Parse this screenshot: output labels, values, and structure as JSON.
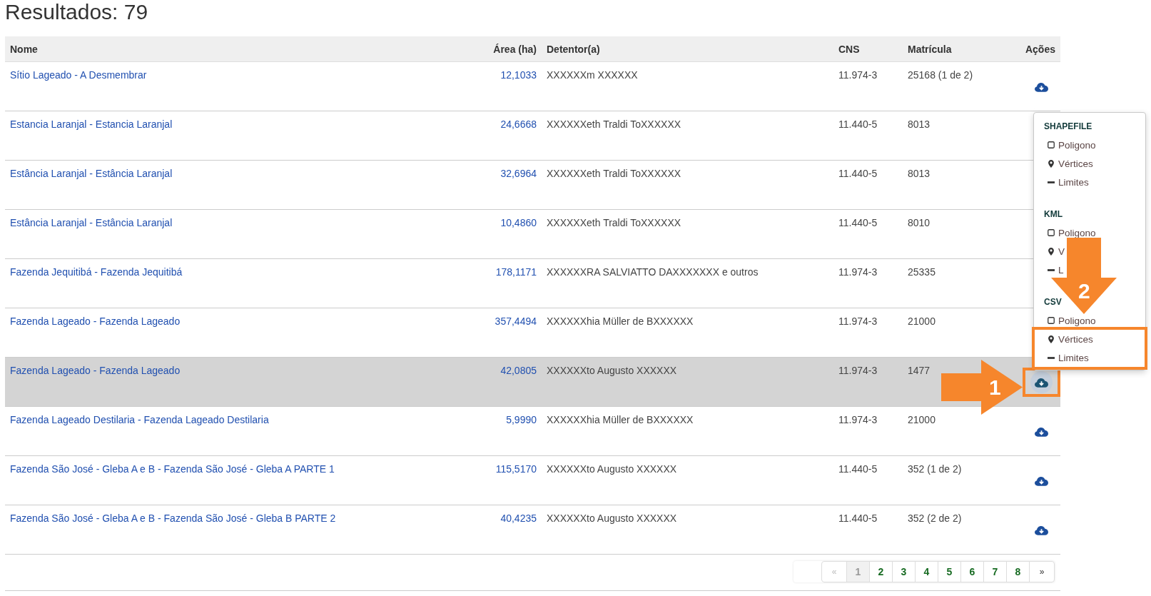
{
  "title": "Resultados: 79",
  "table": {
    "columns": [
      {
        "label": "Nome",
        "kind": "link"
      },
      {
        "label": "Área (ha)",
        "kind": "number"
      },
      {
        "label": "Detentor(a)",
        "kind": "text"
      },
      {
        "label": "CNS",
        "kind": "text"
      },
      {
        "label": "Matrícula",
        "kind": "text"
      },
      {
        "label": "Ações",
        "kind": "actions"
      }
    ],
    "rows": [
      {
        "cells": [
          "Sítio Lageado - A Desmembrar",
          "12,1033",
          "XXXXXXm XXXXXX",
          "11.974-3",
          "25168 (1 de 2)"
        ],
        "selected": false,
        "download": {
          "open": false,
          "highlighted": false
        }
      },
      {
        "cells": [
          "Estancia Laranjal - Estancia Laranjal",
          "24,6668",
          "XXXXXXeth Traldi ToXXXXXX",
          "11.440-5",
          "8013"
        ],
        "selected": false
      },
      {
        "cells": [
          "Estância Laranjal - Estância Laranjal",
          "32,6964",
          "XXXXXXeth Traldi ToXXXXXX",
          "11.440-5",
          "8013"
        ],
        "selected": false
      },
      {
        "cells": [
          "Estância Laranjal - Estância Laranjal",
          "10,4860",
          "XXXXXXeth Traldi ToXXXXXX",
          "11.440-5",
          "8010"
        ],
        "selected": false
      },
      {
        "cells": [
          "Fazenda Jequitibá - Fazenda Jequitibá",
          "178,1171",
          "XXXXXXRA SALVIATTO DAXXXXXXX e outros",
          "11.974-3",
          "25335"
        ],
        "selected": false
      },
      {
        "cells": [
          "Fazenda Lageado - Fazenda Lageado",
          "357,4494",
          "XXXXXXhia Müller de BXXXXXX",
          "11.974-3",
          "21000"
        ],
        "selected": false
      },
      {
        "cells": [
          "Fazenda Lageado - Fazenda Lageado",
          "42,0805",
          "XXXXXXto Augusto XXXXXX",
          "11.974-3",
          "1477"
        ],
        "selected": true,
        "download": {
          "open": true,
          "highlighted": true
        }
      },
      {
        "cells": [
          "Fazenda Lageado Destilaria - Fazenda Lageado Destilaria",
          "5,9990",
          "XXXXXXhia Müller de BXXXXXX",
          "11.974-3",
          "21000"
        ],
        "selected": false,
        "download": {
          "open": false,
          "highlighted": false
        }
      },
      {
        "cells": [
          "Fazenda São José - Gleba A e B - Fazenda São José - Gleba A PARTE 1",
          "115,5170",
          "XXXXXXto Augusto XXXXXX",
          "11.440-5",
          "352 (1 de 2)"
        ],
        "selected": false,
        "download": {
          "open": false,
          "highlighted": false
        }
      },
      {
        "cells": [
          "Fazenda São José - Gleba A e B - Fazenda São José - Gleba B PARTE 2",
          "40,4235",
          "XXXXXXto Augusto XXXXXX",
          "11.440-5",
          "352 (2 de 2)"
        ],
        "selected": false,
        "download": {
          "open": false,
          "highlighted": false
        }
      }
    ]
  },
  "download_menu": {
    "sections": [
      {
        "title": "SHAPEFILE",
        "items": [
          {
            "label": "Poligono",
            "kind": "polygon",
            "highlighted": false
          },
          {
            "label": "Vértices",
            "kind": "points",
            "highlighted": false
          },
          {
            "label": "Limites",
            "kind": "lines",
            "highlighted": false
          }
        ]
      },
      {
        "title": "KML",
        "items": [
          {
            "label": "Poligono",
            "kind": "polygon",
            "highlighted": false
          },
          {
            "label": "V",
            "kind": "points",
            "highlighted": false
          },
          {
            "label": "L",
            "kind": "lines",
            "highlighted": false
          }
        ]
      },
      {
        "title": "CSV",
        "items": [
          {
            "label": "Poligono",
            "kind": "polygon",
            "highlighted": false
          },
          {
            "label": "Vértices",
            "kind": "points",
            "highlighted": true
          },
          {
            "label": "Limites",
            "kind": "lines",
            "highlighted": true
          }
        ]
      }
    ]
  },
  "pagination": {
    "pages": [
      {
        "label": "«",
        "kind": "prev",
        "selected": false,
        "disabled": true
      },
      {
        "label": "1",
        "kind": "page",
        "selected": true,
        "disabled": false
      },
      {
        "label": "2",
        "kind": "page",
        "selected": false,
        "disabled": false
      },
      {
        "label": "3",
        "kind": "page",
        "selected": false,
        "disabled": false
      },
      {
        "label": "4",
        "kind": "page",
        "selected": false,
        "disabled": false
      },
      {
        "label": "5",
        "kind": "page",
        "selected": false,
        "disabled": false
      },
      {
        "label": "6",
        "kind": "page",
        "selected": false,
        "disabled": false
      },
      {
        "label": "7",
        "kind": "page",
        "selected": false,
        "disabled": false
      },
      {
        "label": "8",
        "kind": "page",
        "selected": false,
        "disabled": false
      },
      {
        "label": "»",
        "kind": "next",
        "selected": false,
        "disabled": false
      }
    ]
  },
  "annotations": [
    {
      "kind": "arrow_right",
      "label": "1"
    },
    {
      "kind": "arrow_down",
      "label": "2"
    }
  ]
}
